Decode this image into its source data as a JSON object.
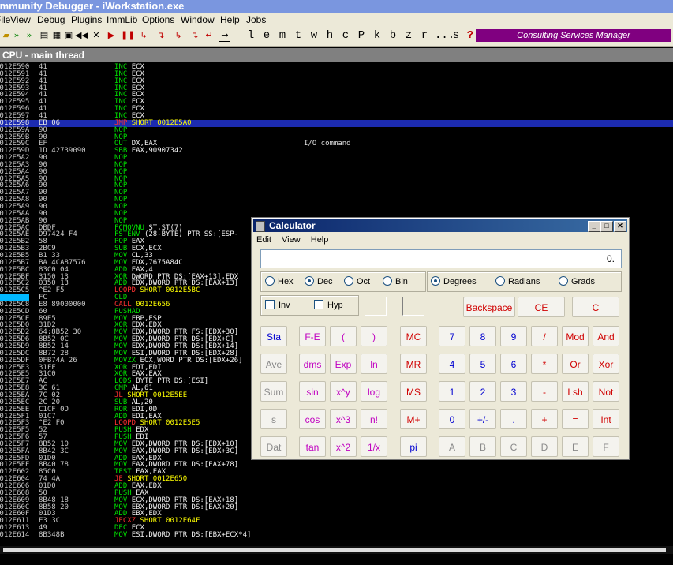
{
  "window": {
    "title": "Immunity Debugger - iWorkstation.exe"
  },
  "menu": [
    "File",
    "View",
    "Debug",
    "Plugins",
    "ImmLib",
    "Options",
    "Window",
    "Help",
    "Jobs"
  ],
  "toolbar": {
    "letters": [
      "l",
      "e",
      "m",
      "t",
      "w",
      "h",
      "c",
      "P",
      "k",
      "b",
      "z",
      "r",
      "...",
      "s",
      "?"
    ],
    "consulting_label": "Consulting Services Manager",
    "consulting_color": "#800080"
  },
  "cpu": {
    "title": "CPU - main thread",
    "selected_color": "#1c2bb0",
    "rows": [
      {
        "addr": "0012E590",
        "hex": "41",
        "mn": "INC",
        "op": "ECX",
        "c": ""
      },
      {
        "addr": "0012E591",
        "hex": "41",
        "mn": "INC",
        "op": "ECX",
        "c": ""
      },
      {
        "addr": "0012E592",
        "hex": "41",
        "mn": "INC",
        "op": "ECX",
        "c": ""
      },
      {
        "addr": "0012E593",
        "hex": "41",
        "mn": "INC",
        "op": "ECX",
        "c": ""
      },
      {
        "addr": "0012E594",
        "hex": "41",
        "mn": "INC",
        "op": "ECX",
        "c": ""
      },
      {
        "addr": "0012E595",
        "hex": "41",
        "mn": "INC",
        "op": "ECX",
        "c": ""
      },
      {
        "addr": "0012E596",
        "hex": "41",
        "mn": "INC",
        "op": "ECX",
        "c": ""
      },
      {
        "addr": "0012E597",
        "hex": "41",
        "mn": "INC",
        "op": "ECX",
        "c": ""
      },
      {
        "addr": "0012E598",
        "hex": "EB 06",
        "mn": "JMP",
        "op": "SHORT 0012E5A0",
        "c": "",
        "sel": true
      },
      {
        "addr": "0012E59A",
        "hex": "90",
        "mn": "NOP",
        "op": "",
        "c": ""
      },
      {
        "addr": "0012E59B",
        "hex": "90",
        "mn": "NOP",
        "op": "",
        "c": ""
      },
      {
        "addr": "0012E59C",
        "hex": "EF",
        "mn": "OUT",
        "op": "DX,EAX",
        "c": "I/O command"
      },
      {
        "addr": "0012E59D",
        "hex": "1D 42739090",
        "mn": "SBB",
        "op": "EAX,90907342",
        "c": ""
      },
      {
        "addr": "0012E5A2",
        "hex": "90",
        "mn": "NOP",
        "op": "",
        "c": ""
      },
      {
        "addr": "0012E5A3",
        "hex": "90",
        "mn": "NOP",
        "op": "",
        "c": ""
      },
      {
        "addr": "0012E5A4",
        "hex": "90",
        "mn": "NOP",
        "op": "",
        "c": ""
      },
      {
        "addr": "0012E5A5",
        "hex": "90",
        "mn": "NOP",
        "op": "",
        "c": ""
      },
      {
        "addr": "0012E5A6",
        "hex": "90",
        "mn": "NOP",
        "op": "",
        "c": ""
      },
      {
        "addr": "0012E5A7",
        "hex": "90",
        "mn": "NOP",
        "op": "",
        "c": ""
      },
      {
        "addr": "0012E5A8",
        "hex": "90",
        "mn": "NOP",
        "op": "",
        "c": ""
      },
      {
        "addr": "0012E5A9",
        "hex": "90",
        "mn": "NOP",
        "op": "",
        "c": ""
      },
      {
        "addr": "0012E5AA",
        "hex": "90",
        "mn": "NOP",
        "op": "",
        "c": ""
      },
      {
        "addr": "0012E5AB",
        "hex": "90",
        "mn": "NOP",
        "op": "",
        "c": ""
      },
      {
        "addr": "0012E5AC",
        "hex": "DBDF",
        "mn": "FCMOVNU",
        "op": "ST,ST(7)",
        "c": ""
      },
      {
        "addr": "0012E5AE",
        "hex": "D97424 F4",
        "mn": "FSTENV",
        "op": "(28-BYTE) PTR SS:[ESP-",
        "c": ""
      },
      {
        "addr": "0012E5B2",
        "hex": "58",
        "mn": "POP",
        "op": "EAX",
        "c": ""
      },
      {
        "addr": "0012E5B3",
        "hex": "2BC9",
        "mn": "SUB",
        "op": "ECX,ECX",
        "c": ""
      },
      {
        "addr": "0012E5B5",
        "hex": "B1 33",
        "mn": "MOV",
        "op": "CL,33",
        "c": ""
      },
      {
        "addr": "0012E5B7",
        "hex": "BA 4CA87576",
        "mn": "MOV",
        "op": "EDX,7675A84C",
        "c": ""
      },
      {
        "addr": "0012E5BC",
        "hex": "83C0 04",
        "mn": "ADD",
        "op": "EAX,4",
        "c": ""
      },
      {
        "addr": "0012E5BF",
        "hex": "3150 13",
        "mn": "XOR",
        "op": "DWORD PTR DS:[EAX+13],EDX",
        "c": ""
      },
      {
        "addr": "0012E5C2",
        "hex": "0350 13",
        "mn": "ADD",
        "op": "EDX,DWORD PTR DS:[EAX+13]",
        "c": ""
      },
      {
        "addr": "0012E5C5",
        "hex": "^E2 F5",
        "mn": "LOOPD",
        "op": "SHORT 0012E5BC",
        "c": ""
      },
      {
        "addr": "0012E5C7",
        "hex": "FC",
        "mn": "CLD",
        "op": "",
        "c": "",
        "cyan": true
      },
      {
        "addr": "0012E5C8",
        "hex": "E8 89000000",
        "mn": "CALL",
        "op": "0012E656",
        "c": ""
      },
      {
        "addr": "0012E5CD",
        "hex": "60",
        "mn": "PUSHAD",
        "op": "",
        "c": ""
      },
      {
        "addr": "0012E5CE",
        "hex": "89E5",
        "mn": "MOV",
        "op": "EBP,ESP",
        "c": ""
      },
      {
        "addr": "0012E5D0",
        "hex": "31D2",
        "mn": "XOR",
        "op": "EDX,EDX",
        "c": ""
      },
      {
        "addr": "0012E5D2",
        "hex": "64:8B52 30",
        "mn": "MOV",
        "op": "EDX,DWORD PTR FS:[EDX+30]",
        "c": ""
      },
      {
        "addr": "0012E5D6",
        "hex": "8B52 0C",
        "mn": "MOV",
        "op": "EDX,DWORD PTR DS:[EDX+C]",
        "c": ""
      },
      {
        "addr": "0012E5D9",
        "hex": "8B52 14",
        "mn": "MOV",
        "op": "EDX,DWORD PTR DS:[EDX+14]",
        "c": ""
      },
      {
        "addr": "0012E5DC",
        "hex": "8B72 28",
        "mn": "MOV",
        "op": "ESI,DWORD PTR DS:[EDX+28]",
        "c": ""
      },
      {
        "addr": "0012E5DF",
        "hex": "0FB74A 26",
        "mn": "MOVZX",
        "op": "ECX,WORD PTR DS:[EDX+26]",
        "c": ""
      },
      {
        "addr": "0012E5E3",
        "hex": "31FF",
        "mn": "XOR",
        "op": "EDI,EDI",
        "c": ""
      },
      {
        "addr": "0012E5E5",
        "hex": "31C0",
        "mn": "XOR",
        "op": "EAX,EAX",
        "c": ""
      },
      {
        "addr": "0012E5E7",
        "hex": "AC",
        "mn": "LODS",
        "op": "BYTE PTR DS:[ESI]",
        "c": ""
      },
      {
        "addr": "0012E5E8",
        "hex": "3C 61",
        "mn": "CMP",
        "op": "AL,61",
        "c": ""
      },
      {
        "addr": "0012E5EA",
        "hex": "7C 02",
        "mn": "JL",
        "op": "SHORT 0012E5EE",
        "c": ""
      },
      {
        "addr": "0012E5EC",
        "hex": "2C 20",
        "mn": "SUB",
        "op": "AL,20",
        "c": ""
      },
      {
        "addr": "0012E5EE",
        "hex": "C1CF 0D",
        "mn": "ROR",
        "op": "EDI,0D",
        "c": ""
      },
      {
        "addr": "0012E5F1",
        "hex": "01C7",
        "mn": "ADD",
        "op": "EDI,EAX",
        "c": ""
      },
      {
        "addr": "0012E5F3",
        "hex": "^E2 F0",
        "mn": "LOOPD",
        "op": "SHORT 0012E5E5",
        "c": ""
      },
      {
        "addr": "0012E5F5",
        "hex": "52",
        "mn": "PUSH",
        "op": "EDX",
        "c": ""
      },
      {
        "addr": "0012E5F6",
        "hex": "57",
        "mn": "PUSH",
        "op": "EDI",
        "c": ""
      },
      {
        "addr": "0012E5F7",
        "hex": "8B52 10",
        "mn": "MOV",
        "op": "EDX,DWORD PTR DS:[EDX+10]",
        "c": ""
      },
      {
        "addr": "0012E5FA",
        "hex": "8B42 3C",
        "mn": "MOV",
        "op": "EAX,DWORD PTR DS:[EDX+3C]",
        "c": ""
      },
      {
        "addr": "0012E5FD",
        "hex": "01D0",
        "mn": "ADD",
        "op": "EAX,EDX",
        "c": ""
      },
      {
        "addr": "0012E5FF",
        "hex": "8B40 78",
        "mn": "MOV",
        "op": "EAX,DWORD PTR DS:[EAX+78]",
        "c": ""
      },
      {
        "addr": "0012E602",
        "hex": "85C0",
        "mn": "TEST",
        "op": "EAX,EAX",
        "c": ""
      },
      {
        "addr": "0012E604",
        "hex": "74 4A",
        "mn": "JE",
        "op": "SHORT 0012E650",
        "c": ""
      },
      {
        "addr": "0012E606",
        "hex": "01D0",
        "mn": "ADD",
        "op": "EAX,EDX",
        "c": ""
      },
      {
        "addr": "0012E608",
        "hex": "50",
        "mn": "PUSH",
        "op": "EAX",
        "c": ""
      },
      {
        "addr": "0012E609",
        "hex": "8B48 18",
        "mn": "MOV",
        "op": "ECX,DWORD PTR DS:[EAX+18]",
        "c": ""
      },
      {
        "addr": "0012E60C",
        "hex": "8B58 20",
        "mn": "MOV",
        "op": "EBX,DWORD PTR DS:[EAX+20]",
        "c": ""
      },
      {
        "addr": "0012E60F",
        "hex": "01D3",
        "mn": "ADD",
        "op": "EBX,EDX",
        "c": ""
      },
      {
        "addr": "0012E611",
        "hex": "E3 3C",
        "mn": "JECXZ",
        "op": "SHORT 0012E64F",
        "c": ""
      },
      {
        "addr": "0012E613",
        "hex": "49",
        "mn": "DEC",
        "op": "ECX",
        "c": ""
      },
      {
        "addr": "0012E614",
        "hex": "8B348B",
        "mn": "MOV",
        "op": "ESI,DWORD PTR DS:[EBX+ECX*4]",
        "c": ""
      }
    ]
  },
  "calculator": {
    "title": "Calculator",
    "menu": [
      "Edit",
      "View",
      "Help"
    ],
    "display": "0.",
    "bases": [
      {
        "label": "Hex",
        "checked": false
      },
      {
        "label": "Dec",
        "checked": true
      },
      {
        "label": "Oct",
        "checked": false
      },
      {
        "label": "Bin",
        "checked": false
      }
    ],
    "angles": [
      {
        "label": "Degrees",
        "checked": true
      },
      {
        "label": "Radians",
        "checked": false
      },
      {
        "label": "Grads",
        "checked": false
      }
    ],
    "checks": [
      {
        "label": "Inv"
      },
      {
        "label": "Hyp"
      }
    ],
    "backspace": "Backspace",
    "ce": "CE",
    "c": "C",
    "keys": [
      [
        {
          "t": "Sta",
          "c": "blue"
        },
        {
          "t": "F-E",
          "c": "mag"
        },
        {
          "t": "(",
          "c": "mag"
        },
        {
          "t": ")",
          "c": "mag"
        },
        {
          "t": "MC",
          "c": "red"
        },
        {
          "t": "7",
          "c": "blue"
        },
        {
          "t": "8",
          "c": "blue"
        },
        {
          "t": "9",
          "c": "blue"
        },
        {
          "t": "/",
          "c": "red"
        },
        {
          "t": "Mod",
          "c": "red"
        },
        {
          "t": "And",
          "c": "red"
        }
      ],
      [
        {
          "t": "Ave",
          "c": "gray"
        },
        {
          "t": "dms",
          "c": "mag"
        },
        {
          "t": "Exp",
          "c": "mag"
        },
        {
          "t": "ln",
          "c": "mag"
        },
        {
          "t": "MR",
          "c": "red"
        },
        {
          "t": "4",
          "c": "blue"
        },
        {
          "t": "5",
          "c": "blue"
        },
        {
          "t": "6",
          "c": "blue"
        },
        {
          "t": "*",
          "c": "red"
        },
        {
          "t": "Or",
          "c": "red"
        },
        {
          "t": "Xor",
          "c": "red"
        }
      ],
      [
        {
          "t": "Sum",
          "c": "gray"
        },
        {
          "t": "sin",
          "c": "mag"
        },
        {
          "t": "x^y",
          "c": "mag"
        },
        {
          "t": "log",
          "c": "mag"
        },
        {
          "t": "MS",
          "c": "red"
        },
        {
          "t": "1",
          "c": "blue"
        },
        {
          "t": "2",
          "c": "blue"
        },
        {
          "t": "3",
          "c": "blue"
        },
        {
          "t": "-",
          "c": "red"
        },
        {
          "t": "Lsh",
          "c": "red"
        },
        {
          "t": "Not",
          "c": "red"
        }
      ],
      [
        {
          "t": "s",
          "c": "gray"
        },
        {
          "t": "cos",
          "c": "mag"
        },
        {
          "t": "x^3",
          "c": "mag"
        },
        {
          "t": "n!",
          "c": "mag"
        },
        {
          "t": "M+",
          "c": "red"
        },
        {
          "t": "0",
          "c": "blue"
        },
        {
          "t": "+/-",
          "c": "blue"
        },
        {
          "t": ".",
          "c": "blue"
        },
        {
          "t": "+",
          "c": "red"
        },
        {
          "t": "=",
          "c": "red"
        },
        {
          "t": "Int",
          "c": "red"
        }
      ],
      [
        {
          "t": "Dat",
          "c": "gray"
        },
        {
          "t": "tan",
          "c": "mag"
        },
        {
          "t": "x^2",
          "c": "mag"
        },
        {
          "t": "1/x",
          "c": "mag"
        },
        {
          "t": "pi",
          "c": "blue"
        },
        {
          "t": "A",
          "c": "gray"
        },
        {
          "t": "B",
          "c": "gray"
        },
        {
          "t": "C",
          "c": "gray"
        },
        {
          "t": "D",
          "c": "gray"
        },
        {
          "t": "E",
          "c": "gray"
        },
        {
          "t": "F",
          "c": "gray"
        }
      ]
    ]
  }
}
